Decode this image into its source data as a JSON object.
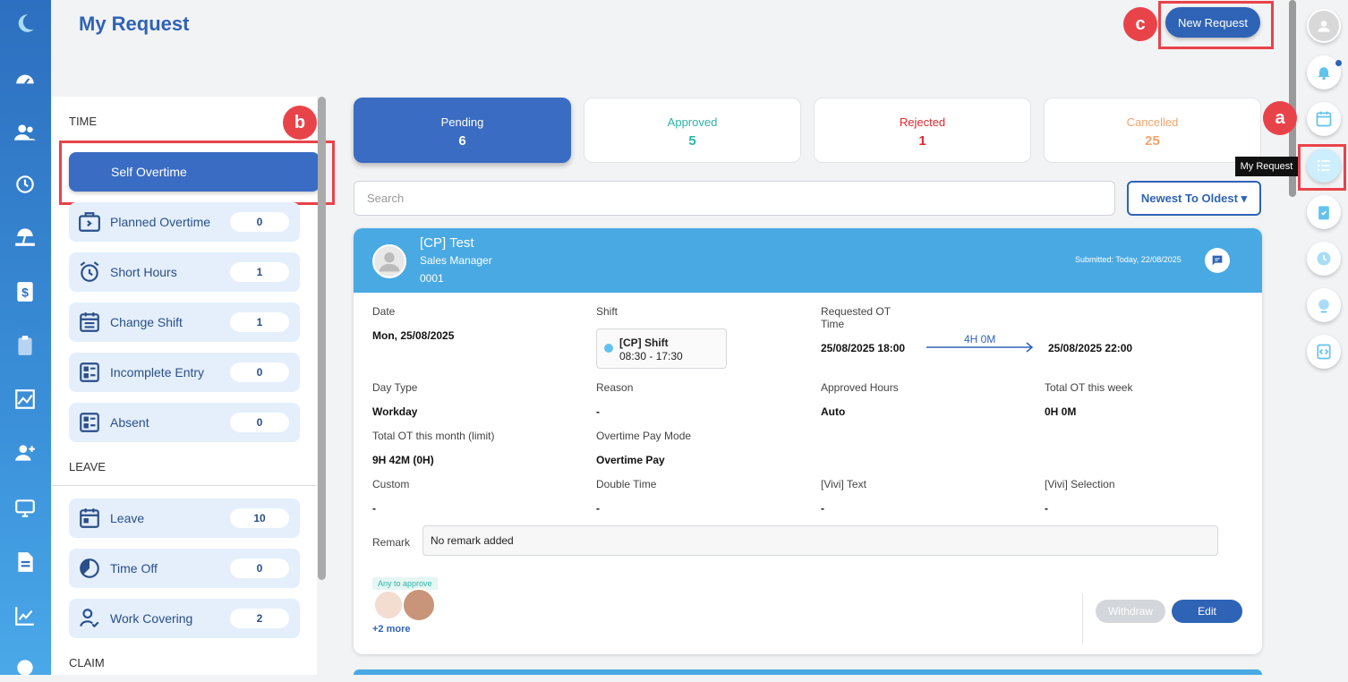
{
  "page": {
    "title": "My Request",
    "new_request_label": "New Request"
  },
  "annotations": {
    "a": "a",
    "b": "b",
    "c": "c"
  },
  "sidebar": {
    "time_heading": "TIME",
    "leave_heading": "LEAVE",
    "claim_heading": "CLAIM",
    "selected": "Self Overtime",
    "time_items": [
      {
        "label": "Planned Overtime",
        "count": "0"
      },
      {
        "label": "Short Hours",
        "count": "1"
      },
      {
        "label": "Change Shift",
        "count": "1"
      },
      {
        "label": "Incomplete Entry",
        "count": "0"
      },
      {
        "label": "Absent",
        "count": "0"
      }
    ],
    "leave_items": [
      {
        "label": "Leave",
        "count": "10"
      },
      {
        "label": "Time Off",
        "count": "0"
      },
      {
        "label": "Work Covering",
        "count": "2"
      }
    ]
  },
  "tabs": [
    {
      "label": "Pending",
      "count": "6"
    },
    {
      "label": "Approved",
      "count": "5"
    },
    {
      "label": "Rejected",
      "count": "1"
    },
    {
      "label": "Cancelled",
      "count": "25"
    }
  ],
  "search": {
    "placeholder": "Search"
  },
  "sort": {
    "label": "Newest To Oldest"
  },
  "card": {
    "name": "[CP] Test",
    "role": "Sales Manager",
    "id": "0001",
    "submitted": "Submitted: Today, 22/08/2025",
    "date_label": "Date",
    "date_value": "Mon, 25/08/2025",
    "shift_label": "Shift",
    "shift_name": "[CP] Shift",
    "shift_time": "08:30 - 17:30",
    "ot_label_1": "Requested OT",
    "ot_label_2": "Time",
    "ot_start": "25/08/2025 18:00",
    "ot_duration": "4H 0M",
    "ot_end": "25/08/2025 22:00",
    "fields": [
      {
        "label": "Day Type",
        "value": "Workday"
      },
      {
        "label": "Reason",
        "value": "-"
      },
      {
        "label": "Approved Hours",
        "value": "Auto"
      },
      {
        "label": "Total OT this week",
        "value": "0H 0M"
      },
      {
        "label": "Total OT this month (limit)",
        "value": "9H 42M (0H)"
      },
      {
        "label": "Overtime Pay Mode",
        "value": "Overtime Pay"
      },
      {
        "label": "Custom",
        "value": "-"
      },
      {
        "label": "Double Time",
        "value": "-"
      },
      {
        "label": "[Vivi] Text",
        "value": "-"
      },
      {
        "label": "[Vivi] Selection",
        "value": "-"
      }
    ],
    "remark_label": "Remark",
    "remark_value": "No remark added",
    "approve_tag": "Any to approve",
    "more_approvers": "+2 more",
    "withdraw_label": "Withdraw",
    "edit_label": "Edit"
  },
  "rightbar": {
    "tooltip": "My Request"
  },
  "colors": {
    "primary": "#2f63b5",
    "approved": "#2bb5a8",
    "rejected": "#e0282e",
    "cancelled": "#f2a46a",
    "card_header": "#49a9e3",
    "annotation": "#e9434a"
  }
}
